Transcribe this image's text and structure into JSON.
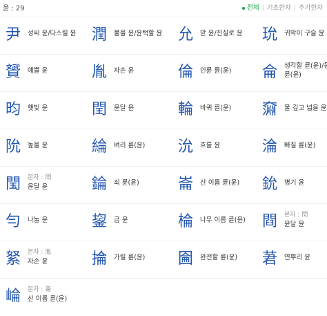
{
  "header": {
    "count_label": "윤 : 29",
    "filters": [
      {
        "label": "전체",
        "active": true
      },
      {
        "label": "기초한자",
        "active": false
      },
      {
        "label": "추가한자",
        "active": false
      }
    ]
  },
  "rows": [
    [
      {
        "hanja": "尹",
        "meaning": "성씨 윤/다스릴 윤"
      },
      {
        "hanja": "潤",
        "meaning": "불을 윤/윤택할 윤"
      },
      {
        "hanja": "允",
        "meaning": "맏 윤/진실로 윤"
      },
      {
        "hanja": "玧",
        "meaning": "귀막이 구슬 윤"
      }
    ],
    [
      {
        "hanja": "贇",
        "meaning": "예쁠 윤"
      },
      {
        "hanja": "胤",
        "meaning": "자손 윤"
      },
      {
        "hanja": "倫",
        "meaning": "인륜 륜(윤)"
      },
      {
        "hanja": "侖",
        "meaning": "생각할 륜(윤)/등",
        "meaning2": "륜(윤)"
      }
    ],
    [
      {
        "hanja": "昀",
        "meaning": "햇빛 윤"
      },
      {
        "hanja": "閏",
        "meaning": "윤달 윤"
      },
      {
        "hanja": "輪",
        "meaning": "바퀴 륜(윤)"
      },
      {
        "hanja": "奫",
        "meaning": "물 깊고 넓을 윤"
      }
    ],
    [
      {
        "hanja": "阭",
        "meaning": "높을 윤"
      },
      {
        "hanja": "綸",
        "meaning": "벼리 륜(윤)"
      },
      {
        "hanja": "沇",
        "meaning": "흐를 윤"
      },
      {
        "hanja": "淪",
        "meaning": "빠질 륜(윤)"
      }
    ],
    [
      {
        "hanja": "閠",
        "sub": "본자 : 閏",
        "meaning": "윤달 윤"
      },
      {
        "hanja": "錀",
        "meaning": "쇠 륜(윤)"
      },
      {
        "hanja": "崙",
        "meaning": "산 이름 륜(윤)"
      },
      {
        "hanja": "鈗",
        "meaning": "병기 윤"
      }
    ],
    [
      {
        "hanja": "勻",
        "meaning": "나눌 윤"
      },
      {
        "hanja": "鋆",
        "meaning": "금 윤"
      },
      {
        "hanja": "棆",
        "meaning": "나무 이름 륜(윤)"
      },
      {
        "hanja": "閰",
        "sub": "본자 : 閏",
        "meaning": "윤달 윤"
      }
    ],
    [
      {
        "hanja": "䋈",
        "sub": "본자 : 胤",
        "meaning": "자손 윤"
      },
      {
        "hanja": "掄",
        "meaning": "가릴 륜(윤)"
      },
      {
        "hanja": "圇",
        "meaning": "완전할 륜(윤)"
      },
      {
        "hanja": "莙",
        "meaning": "연뿌리 윤"
      }
    ],
    [
      {
        "hanja": "崘",
        "sub": "본자 : 崙",
        "meaning": "산 이름 륜(윤)"
      }
    ]
  ]
}
